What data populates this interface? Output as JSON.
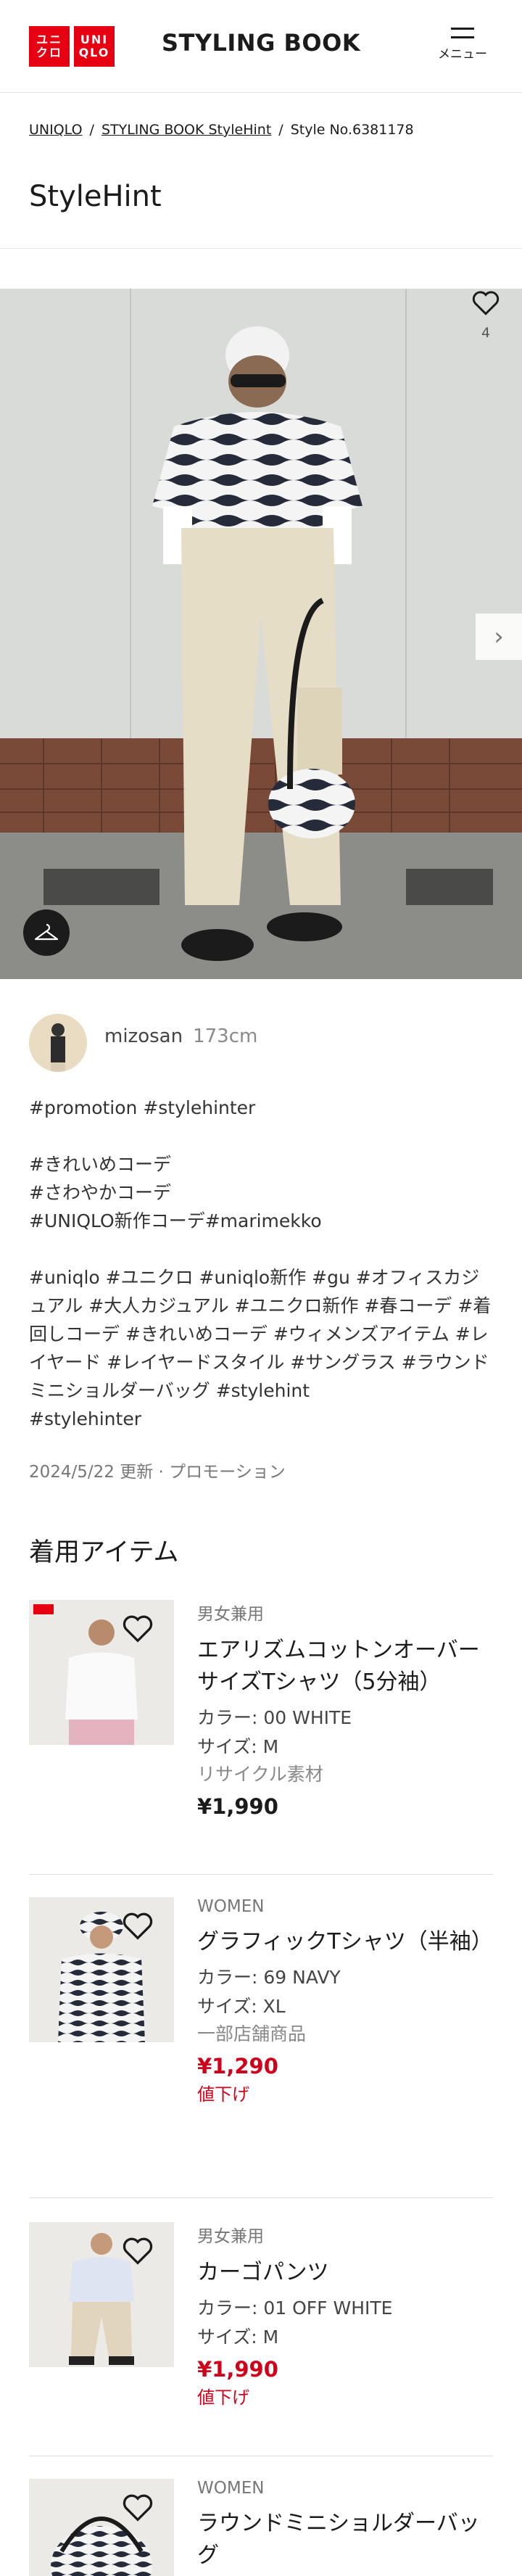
{
  "header": {
    "title": "STYLING BOOK",
    "menu_label": "メニュー",
    "logo_line1": "ユニ",
    "logo_line2": "クロ",
    "logo_line3": "UNI",
    "logo_line4": "QLO"
  },
  "breadcrumb": {
    "items": [
      "UNIQLO",
      "STYLING BOOK StyleHint",
      "Style No.6381178"
    ],
    "separator": "/"
  },
  "page_title": "StyleHint",
  "hero": {
    "like_count": "4",
    "next_arrow": "›"
  },
  "author": {
    "name": "mizosan",
    "height": "173cm"
  },
  "description": "#promotion #stylehinter\n\n#きれいめコーデ\n#さわやかコーデ\n#UNIQLO新作コーデ#marimekko\n\n#uniqlo #ユニクロ #uniqlo新作 #gu #オフィスカジュアル #大人カジュアル #ユニクロ新作 #春コーデ #着回しコーデ #きれいめコーデ #ウィメンズアイテム #レイヤード #レイヤードスタイル #サングラス #ラウンドミニショルダーバッグ #stylehint\n#stylehinter",
  "meta": "2024/5/22 更新 · プロモーション",
  "section_title": "着用アイテム",
  "items": [
    {
      "gender": "男女兼用",
      "name": "エアリズムコットンオーバーサイズTシャツ（5分袖）",
      "color": "カラー: 00 WHITE",
      "size": "サイズ: M",
      "note": "リサイクル素材",
      "price": "¥1,990",
      "sale": ""
    },
    {
      "gender": "WOMEN",
      "name": "グラフィックTシャツ（半袖）",
      "color": "カラー: 69 NAVY",
      "size": "サイズ: XL",
      "note": "一部店舗商品",
      "price": "¥1,290",
      "sale": "値下げ"
    },
    {
      "gender": "男女兼用",
      "name": "カーゴパンツ",
      "color": "カラー: 01 OFF WHITE",
      "size": "サイズ: M",
      "note": "",
      "price": "¥1,990",
      "sale": "値下げ"
    },
    {
      "gender": "WOMEN",
      "name": "ラウンドミニショルダーバッグ",
      "color": "",
      "size": "",
      "note": "",
      "price": "",
      "sale": ""
    }
  ],
  "colors": {
    "brand_red": "#e60012",
    "sale_red": "#d0021b"
  }
}
